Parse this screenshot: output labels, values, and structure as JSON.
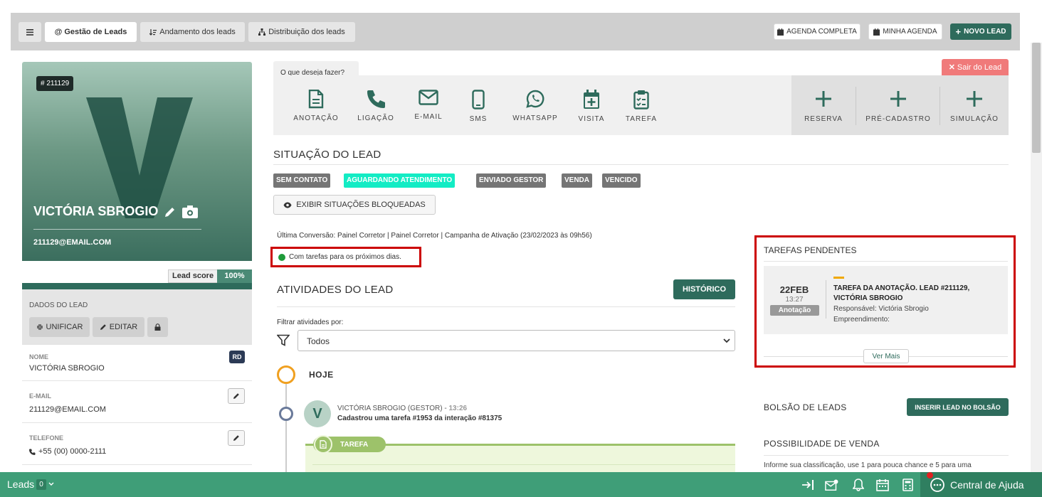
{
  "nav": {
    "menu_icon": "hamburger-icon",
    "tabs": [
      {
        "label": "@ Gestão de Leads"
      },
      {
        "label": "Andamento dos leads"
      },
      {
        "label": "Distribuição dos leads"
      }
    ],
    "agenda_completa": "AGENDA COMPLETA",
    "minha_agenda": "MINHA AGENDA",
    "novo_lead": "NOVO LEAD"
  },
  "profile": {
    "id": "# 211129",
    "initial": "V",
    "name": "VICTÓRIA SBROGIO",
    "email": "211129@EMAIL.COM",
    "lead_score_label": "Lead score",
    "lead_score_value": "100%"
  },
  "dados": {
    "title": "DADOS DO LEAD",
    "unificar": "UNIFICAR",
    "editar": "EDITAR",
    "fields": [
      {
        "label": "NOME",
        "value": "VICTÓRIA SBROGIO",
        "badge": "RD"
      },
      {
        "label": "E-MAIL",
        "value": "211129@EMAIL.COM"
      },
      {
        "label": "TELEFONE",
        "value": "+55 (00) 0000-2111"
      }
    ]
  },
  "actions": {
    "prompt": "O que deseja fazer?",
    "sair": "Sair do Lead",
    "items": [
      {
        "label": "ANOTAÇÃO"
      },
      {
        "label": "LIGAÇÃO"
      },
      {
        "label": "E-MAIL"
      },
      {
        "label": "SMS"
      },
      {
        "label": "WHATSAPP"
      },
      {
        "label": "VISITA"
      },
      {
        "label": "TAREFA"
      }
    ],
    "right": [
      {
        "label": "RESERVA"
      },
      {
        "label": "PRÉ-CADASTRO"
      },
      {
        "label": "SIMULAÇÃO"
      }
    ]
  },
  "situacao": {
    "title": "SITUAÇÃO DO LEAD",
    "statuses": [
      {
        "label": "SEM CONTATO"
      },
      {
        "label": "AGUARDANDO ATENDIMENTO"
      },
      {
        "label": "ENVIADO GESTOR"
      },
      {
        "label": "VENDA"
      },
      {
        "label": "VENCIDO"
      }
    ],
    "bloqueadas": "EXIBIR SITUAÇÕES BLOQUEADAS",
    "ultima_conversao": "Última Conversão: Painel Corretor | Painel Corretor | Campanha de Ativação (23/02/2023 às 09h56)",
    "tarefas_note": "Com tarefas para os próximos dias."
  },
  "atividades": {
    "title": "ATIVIDADES DO LEAD",
    "historico": "HISTÓRICO",
    "filtrar_label": "Filtrar atividades por:",
    "filtro_value": "Todos",
    "hoje": "HOJE",
    "entry": {
      "avatar": "V",
      "author": "VICTÓRIA SBROGIO (GESTOR) - ",
      "time": "13:26",
      "desc": "Cadastrou uma tarefa #1953 da interação #81375",
      "tag": "TAREFA"
    }
  },
  "pendentes": {
    "title": "TAREFAS PENDENTES",
    "task": {
      "date": "22FEB",
      "hour": "13:27",
      "type": "Anotação",
      "title": "TAREFA DA ANOTAÇÃO. LEAD #211129, VICTÓRIA SBROGIO",
      "responsavel": "Responsável: Victória Sbrogio",
      "empreendimento": "Empreendimento:"
    },
    "ver_mais": "Ver Mais"
  },
  "bolsao": {
    "title": "BOLSÃO DE LEADS",
    "button": "INSERIR LEAD NO BOLSÃO"
  },
  "possibilidade": {
    "title": "POSSIBILIDADE DE VENDA",
    "desc": "Informe sua classificação, use 1 para pouca chance e 5 para uma"
  },
  "bottom": {
    "leads_label": "Leads",
    "leads_count": "0",
    "ajuda": "Central de Ajuda"
  },
  "colors": {
    "brand_green": "#2e6b5c",
    "bottom_green": "#3f9e78",
    "highlight_red": "#cc0000",
    "status_active": "#13ecc4"
  }
}
